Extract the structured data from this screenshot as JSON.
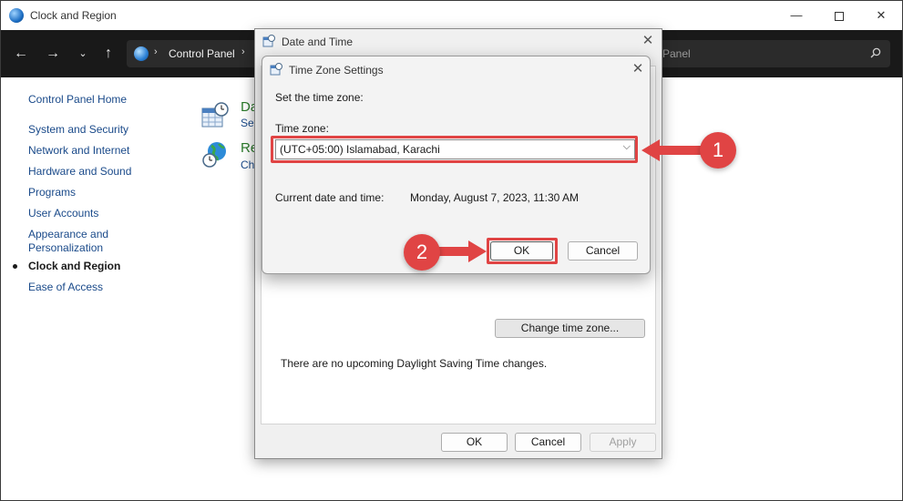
{
  "window": {
    "title": "Clock and Region",
    "minimize_glyph": "—",
    "close_glyph": "✕"
  },
  "navbar": {
    "address_text": "Control Panel",
    "search_text": "Panel",
    "back_glyph": "←",
    "forward_glyph": "→",
    "recent_glyph": "⌄",
    "up_glyph": "↑",
    "chevron": "›"
  },
  "sidebar": {
    "items": [
      {
        "label": "Control Panel Home"
      },
      {
        "label": "System and Security"
      },
      {
        "label": "Network and Internet"
      },
      {
        "label": "Hardware and Sound"
      },
      {
        "label": "Programs"
      },
      {
        "label": "User Accounts"
      },
      {
        "label": "Appearance and Personalization"
      },
      {
        "label": "Clock and Region",
        "active": true
      },
      {
        "label": "Ease of Access"
      }
    ]
  },
  "content": {
    "categories": [
      {
        "title": "Da",
        "link": "Set"
      },
      {
        "title": "Re",
        "link": "Ch"
      }
    ]
  },
  "date_time_dialog": {
    "title": "Date and Time",
    "close_glyph": "✕",
    "change_tz_button": "Change time zone...",
    "dst_text": "There are no upcoming Daylight Saving Time changes.",
    "ok_button": "OK",
    "cancel_button": "Cancel",
    "apply_button": "Apply"
  },
  "tz_dialog": {
    "title": "Time Zone Settings",
    "close_glyph": "✕",
    "heading": "Set the time zone:",
    "tz_label": "Time zone:",
    "tz_value": "(UTC+05:00) Islamabad, Karachi",
    "tz_chevron": "⌵",
    "current_label": "Current date and time:",
    "current_value": "Monday, August 7, 2023, 11:30 AM",
    "ok_button": "OK",
    "cancel_button": "Cancel"
  },
  "callouts": [
    {
      "number": "1"
    },
    {
      "number": "2"
    }
  ],
  "colors": {
    "highlight_red": "#e04444",
    "link_blue": "#1a4a8a",
    "category_green": "#2a7a2a"
  }
}
